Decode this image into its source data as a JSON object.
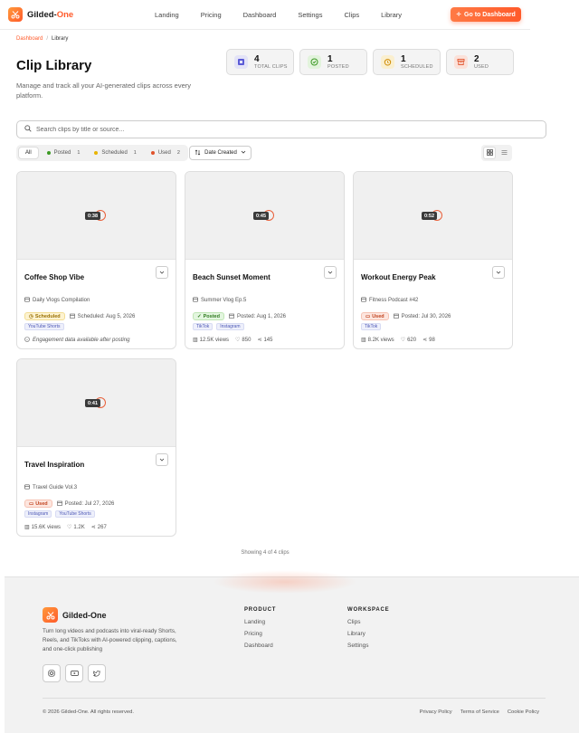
{
  "brand": {
    "name_main": "Gilded-",
    "name_accent": "One",
    "accent_color": "#ff5a2a"
  },
  "nav": {
    "links": [
      "Landing",
      "Pricing",
      "Dashboard",
      "Settings",
      "Clips",
      "Library"
    ],
    "cta": "Go to Dashboard"
  },
  "breadcrumb": {
    "home": "Dashboard",
    "separator": "/",
    "current": "Library"
  },
  "page": {
    "title": "Clip Library",
    "subtitle": "Manage and track all your AI-generated clips across every platform."
  },
  "stats": [
    {
      "value": "4",
      "label": "TOTAL CLIPS",
      "icon": "film-icon",
      "color": "#5b5bd6"
    },
    {
      "value": "1",
      "label": "POSTED",
      "icon": "check-circle-icon",
      "color": "#3c9a24"
    },
    {
      "value": "1",
      "label": "SCHEDULED",
      "icon": "clock-icon",
      "color": "#d08a00"
    },
    {
      "value": "2",
      "label": "USED",
      "icon": "archive-icon",
      "color": "#e0532b"
    }
  ],
  "search": {
    "placeholder": "Search clips by title or source..."
  },
  "filters": [
    {
      "label": "All",
      "count": "",
      "dot": ""
    },
    {
      "label": "Posted",
      "count": "1",
      "dot": "#3c9a24"
    },
    {
      "label": "Scheduled",
      "count": "1",
      "dot": "#e8b400"
    },
    {
      "label": "Used",
      "count": "2",
      "dot": "#e0532b"
    }
  ],
  "sort": {
    "label": "Date Created"
  },
  "clips": [
    {
      "duration": "0:38",
      "title": "Coffee Shop Vibe",
      "source": "Daily Vlogs Compilation",
      "status": "Scheduled",
      "date": "Scheduled: Aug 5, 2026",
      "tags": [
        "YouTube Shorts"
      ],
      "note": "Engagement data available after posting"
    },
    {
      "duration": "0:45",
      "title": "Beach Sunset Moment",
      "source": "Summer Vlog Ep.5",
      "status": "Posted",
      "date": "Posted: Aug 1, 2026",
      "tags": [
        "TikTok",
        "Instagram"
      ],
      "views": "12.5K views",
      "likes": "850",
      "shares": "145"
    },
    {
      "duration": "0:52",
      "title": "Workout Energy Peak",
      "source": "Fitness Podcast #42",
      "status": "Used",
      "date": "Posted: Jul 30, 2026",
      "tags": [
        "TikTok"
      ],
      "views": "8.2K views",
      "likes": "620",
      "shares": "98"
    },
    {
      "duration": "0:41",
      "title": "Travel Inspiration",
      "source": "Travel Guide Vol.3",
      "status": "Used",
      "date": "Posted: Jul 27, 2026",
      "tags": [
        "Instagram",
        "YouTube Shorts"
      ],
      "views": "15.6K views",
      "likes": "1.2K",
      "shares": "267"
    }
  ],
  "showing": "Showing 4 of 4 clips",
  "footer": {
    "description": "Turn long videos and podcasts into viral-ready Shorts, Reels, and TikToks with AI-powered clipping, captions, and one-click publishing",
    "product": {
      "heading": "PRODUCT",
      "links": [
        "Landing",
        "Pricing",
        "Dashboard"
      ]
    },
    "workspace": {
      "heading": "WORKSPACE",
      "links": [
        "Clips",
        "Library",
        "Settings"
      ]
    },
    "copyright": "© 2026 Gilded-One. All rights reserved.",
    "legal": [
      "Privacy Policy",
      "Terms of Service",
      "Cookie Policy"
    ]
  }
}
